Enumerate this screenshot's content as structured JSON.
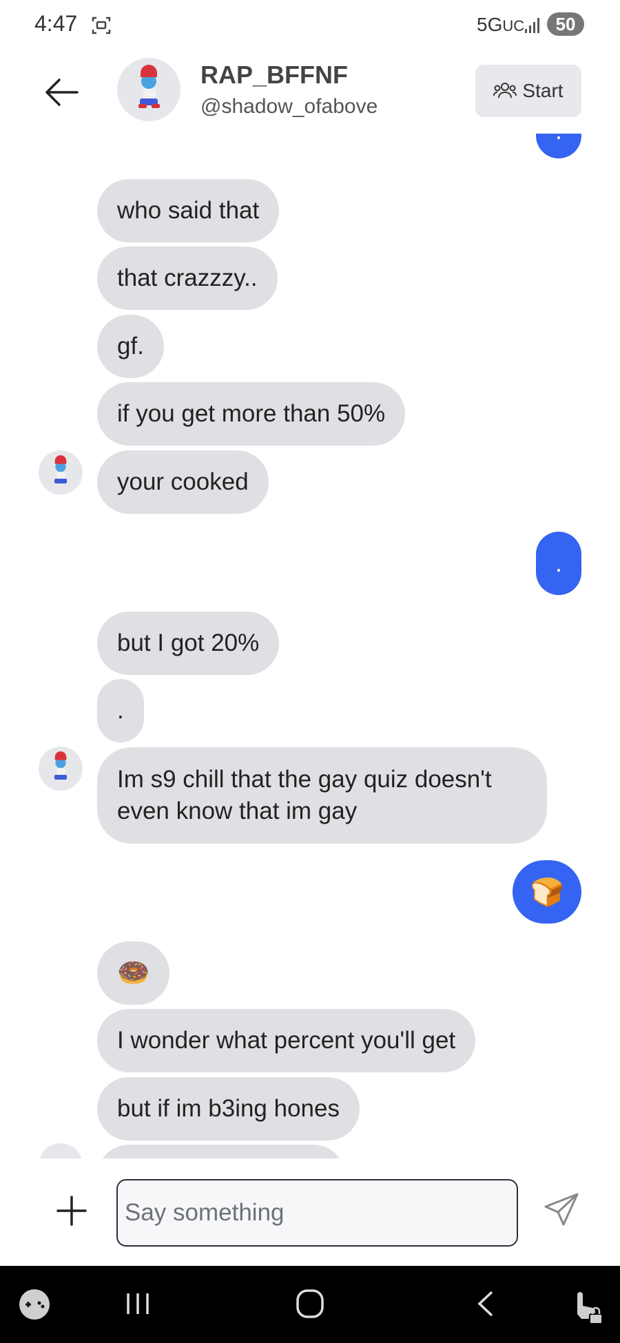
{
  "status_bar": {
    "time": "4:47",
    "network": "5G",
    "network_suffix": "UC",
    "battery": "50"
  },
  "header": {
    "name": "RAP_BFFNF",
    "handle": "@shadow_ofabove",
    "start_label": "Start"
  },
  "messages": [
    {
      "from": "me",
      "text": "."
    },
    {
      "from": "them",
      "text": "who said that"
    },
    {
      "from": "them",
      "text": "that crazzzy.."
    },
    {
      "from": "them",
      "text": "gf."
    },
    {
      "from": "them",
      "text": "if you get more than 50%"
    },
    {
      "from": "them",
      "text": "your cooked"
    },
    {
      "from": "me",
      "text": "."
    },
    {
      "from": "them",
      "text": "but I got 20%"
    },
    {
      "from": "them",
      "text": "."
    },
    {
      "from": "them",
      "text": "Im s9 chill that the gay quiz doesn't even know that im gay"
    },
    {
      "from": "me",
      "text": "🍞"
    },
    {
      "from": "them",
      "text": "🍩"
    },
    {
      "from": "them",
      "text": "I wonder what percent you'll get"
    },
    {
      "from": "them",
      "text": "but if im b3ing hones"
    }
  ],
  "composer": {
    "placeholder": "Say something"
  },
  "colors": {
    "outgoing_bubble": "#3563f2",
    "incoming_bubble": "#dfe0e3",
    "nav_bar": "#000000"
  },
  "icons": {
    "back": "arrow-left-icon",
    "start": "users-icon",
    "add": "plus-icon",
    "send": "paper-plane-icon",
    "nav_game": "gamepad-icon",
    "nav_recents": "recents-icon",
    "nav_home": "home-icon",
    "nav_back": "chevron-left-icon",
    "nav_touch_lock": "touch-lock-icon"
  }
}
